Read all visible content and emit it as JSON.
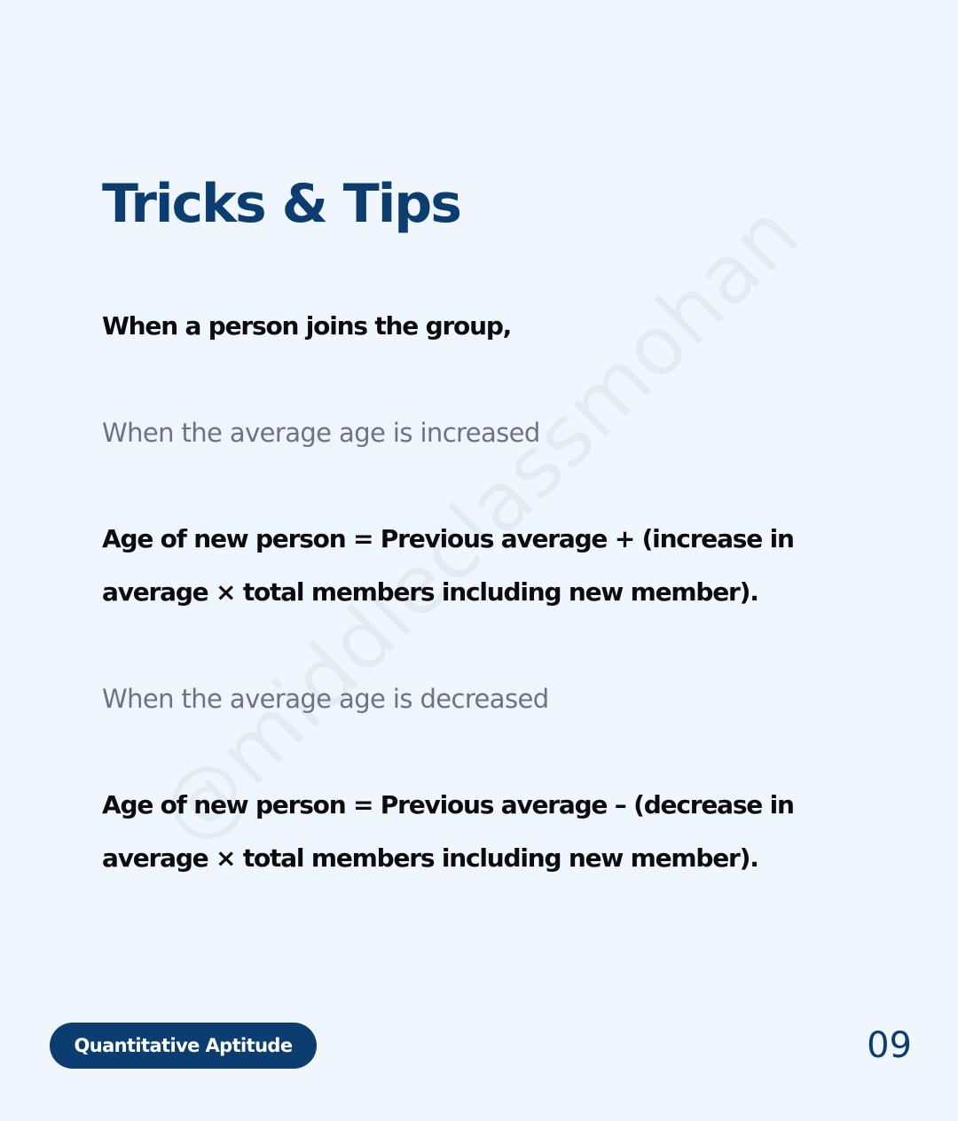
{
  "watermark": "@middleclassmohan",
  "title": "Tricks & Tips",
  "intro": "When a person joins the group,",
  "increase": {
    "heading": "When the average age is increased",
    "formula_line1": "Age of new person = Previous average + (increase in",
    "formula_line2": "average × total members including new member)."
  },
  "decrease": {
    "heading": "When the average age is decreased",
    "formula_line1": "Age of new person = Previous average – (decrease in",
    "formula_line2": "average × total members including new member)."
  },
  "footer": {
    "badge_label": "Quantitative Aptitude",
    "page_number": "09"
  },
  "colors": {
    "background": "#eff6fd",
    "accent": "#0c3d70",
    "muted_text": "#6b7385",
    "body_text": "#0b0b10"
  }
}
